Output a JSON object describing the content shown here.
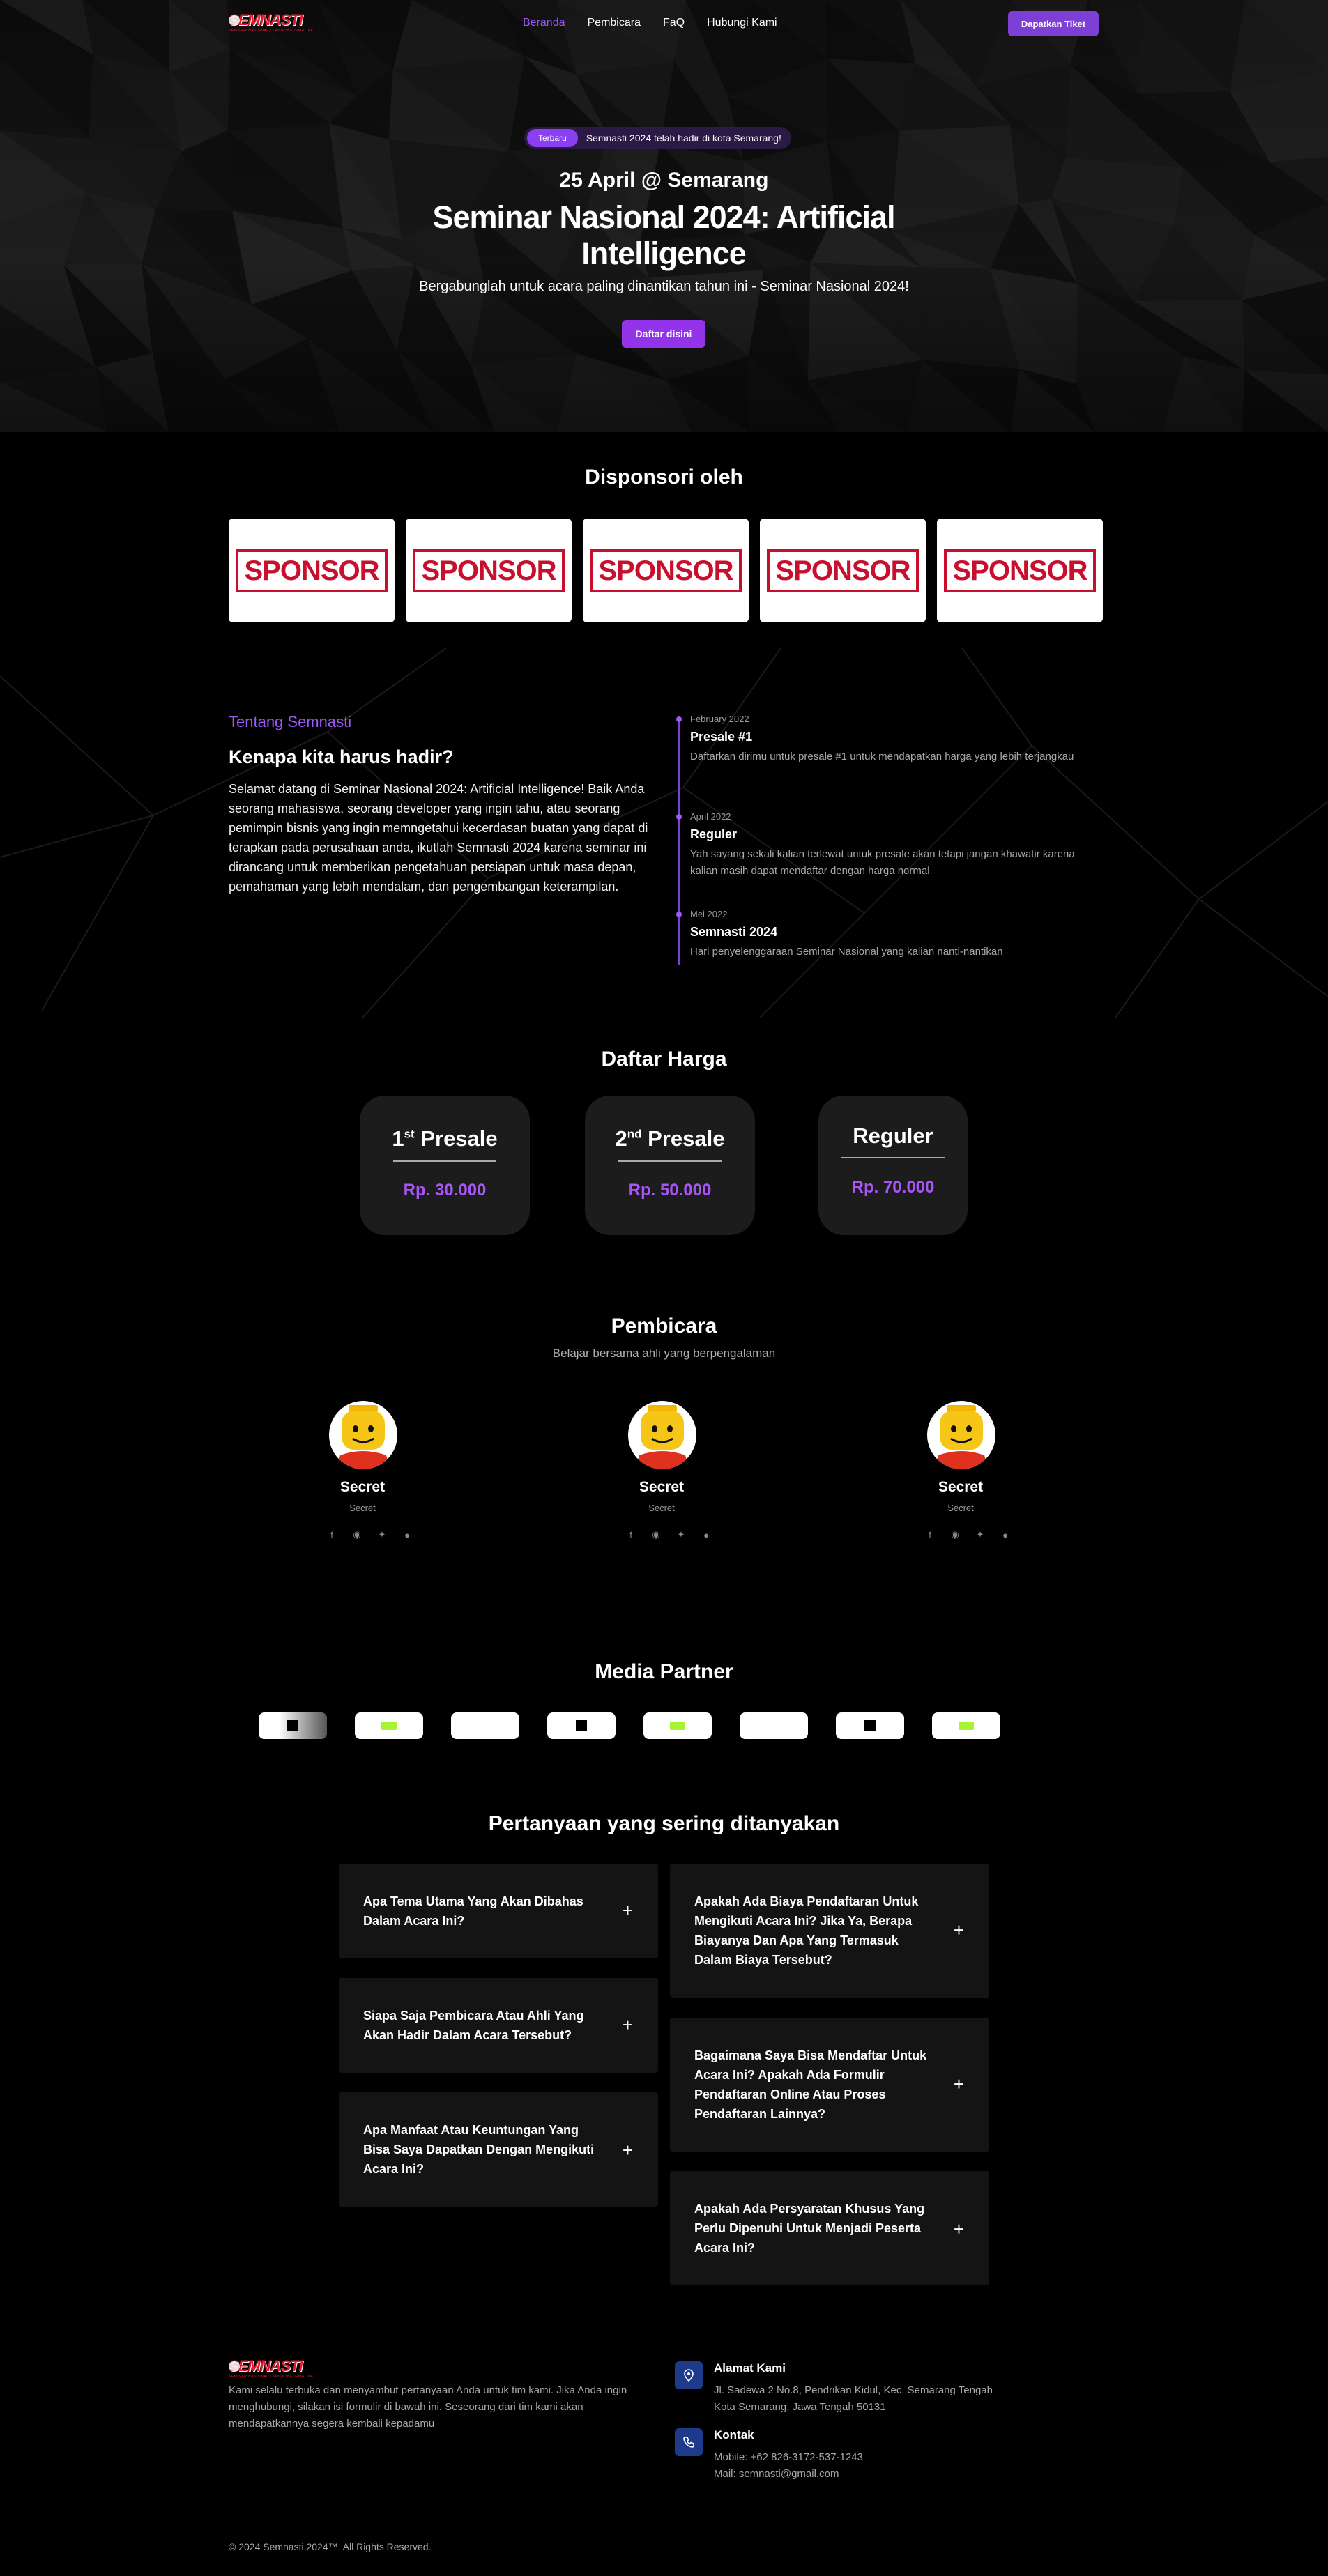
{
  "nav": {
    "logo_text": "SEMNASTI",
    "logo_sub": "SEMINAR NASIONAL TEKNIK INFORMATIKA",
    "links": [
      "Beranda",
      "Pembicara",
      "FaQ",
      "Hubungi Kami"
    ],
    "active_link": "Beranda",
    "ticket_label": "Dapatkan Tiket"
  },
  "hero": {
    "badge_tag": "Terbaru",
    "badge_text": "Semnasti 2024 telah hadir di kota Semarang!",
    "date": "25 April @ Semarang",
    "title": "Seminar Nasional 2024: Artificial Intelligence",
    "subtitle": "Bergabunglah untuk acara paling dinantikan tahun ini - Seminar Nasional 2024!",
    "cta": "Daftar disini"
  },
  "sponsors": {
    "title": "Disponsori oleh",
    "items": [
      "SPONSOR",
      "SPONSOR",
      "SPONSOR",
      "SPONSOR",
      "SPONSOR"
    ]
  },
  "about": {
    "eyebrow": "Tentang Semnasti",
    "title": "Kenapa kita harus hadir?",
    "body": "Selamat datang di Seminar Nasional 2024: Artificial Intelligence! Baik Anda seorang mahasiswa, seorang developer yang ingin tahu, atau seorang pemimpin bisnis yang ingin memngetahui kecerdasan buatan yang dapat di terapkan pada perusahaan anda, ikutlah Semnasti 2024 karena seminar ini dirancang untuk memberikan pengetahuan persiapan untuk masa depan, pemahaman yang lebih mendalam, dan pengembangan keterampilan.",
    "timeline": [
      {
        "date": "February 2022",
        "title": "Presale #1",
        "desc": "Daftarkan dirimu untuk presale #1 untuk mendapatkan harga yang lebih terjangkau"
      },
      {
        "date": "April 2022",
        "title": "Reguler",
        "desc": "Yah sayang sekali kalian terlewat untuk presale akan tetapi jangan khawatir karena kalian masih dapat mendaftar dengan harga normal"
      },
      {
        "date": "Mei 2022",
        "title": "Semnasti 2024",
        "desc": "Hari penyelenggaraan Seminar Nasional yang kalian nanti-nantikan"
      }
    ]
  },
  "prices": {
    "title": "Daftar Harga",
    "items": [
      {
        "num": "1",
        "sup": "st",
        "label": "Presale",
        "amount": "Rp. 30.000"
      },
      {
        "num": "2",
        "sup": "nd",
        "label": "Presale",
        "amount": "Rp. 50.000"
      },
      {
        "num": "",
        "sup": "",
        "label": "Reguler",
        "amount": "Rp. 70.000"
      }
    ]
  },
  "speakers": {
    "title": "Pembicara",
    "subtitle": "Belajar bersama ahli yang berpengalaman",
    "items": [
      {
        "name": "Secret",
        "role": "Secret"
      },
      {
        "name": "Secret",
        "role": "Secret"
      },
      {
        "name": "Secret",
        "role": "Secret"
      }
    ]
  },
  "media": {
    "title": "Media Partner"
  },
  "faq": {
    "title": "Pertanyaan yang sering ditanyakan",
    "left": [
      "Apa Tema Utama Yang Akan Dibahas Dalam Acara Ini?",
      "Siapa Saja Pembicara Atau Ahli Yang Akan Hadir Dalam Acara Tersebut?",
      "Apa Manfaat Atau Keuntungan Yang Bisa Saya Dapatkan Dengan Mengikuti Acara Ini?"
    ],
    "right": [
      "Apakah Ada Biaya Pendaftaran Untuk Mengikuti Acara Ini? Jika Ya, Berapa Biayanya Dan Apa Yang Termasuk Dalam Biaya Tersebut?",
      "Bagaimana Saya Bisa Mendaftar Untuk Acara Ini? Apakah Ada Formulir Pendaftaran Online Atau Proses Pendaftaran Lainnya?",
      "Apakah Ada Persyaratan Khusus Yang Perlu Dipenuhi Untuk Menjadi Peserta Acara Ini?"
    ],
    "plus": "+"
  },
  "footer": {
    "about": "Kami selalu terbuka dan menyambut pertanyaan Anda untuk tim kami. Jika Anda ingin menghubungi, silakan isi formulir di bawah ini. Seseorang dari tim kami akan mendapatkannya segera kembali kepadamu",
    "address_title": "Alamat Kami",
    "address_1": "Jl. Sadewa 2 No.8, Pendrikan Kidul, Kec. Semarang Tengah",
    "address_2": "Kota Semarang, Jawa Tengah 50131",
    "contact_title": "Kontak",
    "mobile": "Mobile: +62 826-3172-537-1243",
    "mail": "Mail: semnasti@gmail.com",
    "copyright": "© 2024 Semnasti 2024™. All Rights Reserved."
  },
  "colors": {
    "accent": "#9333ea",
    "accent_text": "#a855f7",
    "card": "#1c1c1c",
    "faq_card": "#141414",
    "icon_bg": "#1e3a8a"
  }
}
